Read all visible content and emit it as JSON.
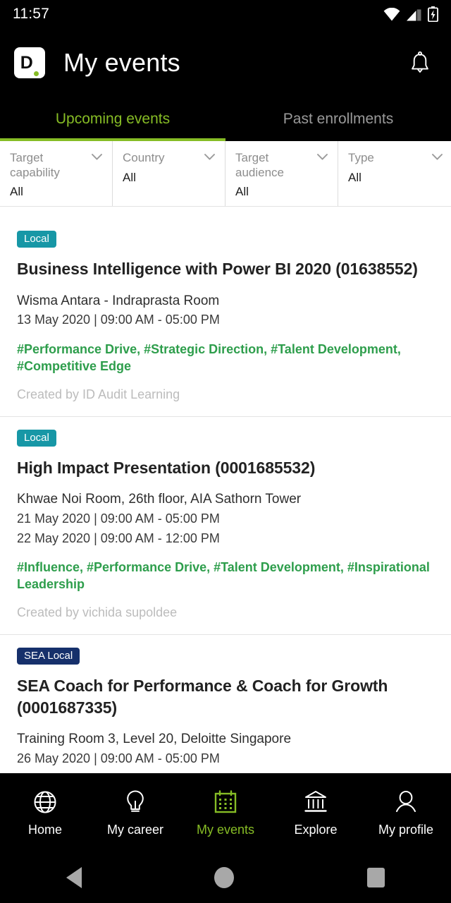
{
  "status_bar": {
    "time": "11:57",
    "icons": [
      "wifi-icon",
      "cellular-signal-icon",
      "battery-charging-icon"
    ]
  },
  "app_bar": {
    "logo_letter": "D",
    "logo_name": "deloitte-logo",
    "title": "My events",
    "notification_icon": "bell-icon"
  },
  "tabs": [
    {
      "label": "Upcoming events",
      "active": true
    },
    {
      "label": "Past enrollments",
      "active": false
    }
  ],
  "filters": [
    {
      "label": "Target capability",
      "value": "All"
    },
    {
      "label": "Country",
      "value": "All"
    },
    {
      "label": "Target audience",
      "value": "All"
    },
    {
      "label": "Type",
      "value": "All"
    }
  ],
  "events": [
    {
      "badge": "Local",
      "badge_type": "local",
      "title": "Business Intelligence with Power BI 2020 (01638552)",
      "venue": "Wisma Antara - Indraprasta Room",
      "dates": [
        "13 May 2020 | 09:00 AM - 05:00 PM"
      ],
      "tags": "#Performance Drive, #Strategic Direction, #Talent Development, #Competitive Edge",
      "author": "Created by ID Audit Learning"
    },
    {
      "badge": "Local",
      "badge_type": "local",
      "title": "High Impact Presentation (0001685532)",
      "venue": "Khwae Noi Room, 26th floor, AIA Sathorn Tower",
      "dates": [
        "21 May 2020 | 09:00 AM - 05:00 PM",
        "22 May 2020 | 09:00 AM - 12:00 PM"
      ],
      "tags": "#Influence, #Performance Drive, #Talent Development, #Inspirational Leadership",
      "author": "Created by vichida supoldee"
    },
    {
      "badge": "SEA Local",
      "badge_type": "sea",
      "title": "SEA Coach for Performance & Coach for Growth (0001687335)",
      "venue": "Training Room 3, Level 20, Deloitte Singapore",
      "dates": [
        "26 May 2020 | 09:00 AM - 05:00 PM"
      ],
      "tags": "",
      "author": ""
    }
  ],
  "bottom_nav": [
    {
      "label": "Home",
      "icon": "globe-icon",
      "active": false
    },
    {
      "label": "My career",
      "icon": "lightbulb-icon",
      "active": false
    },
    {
      "label": "My events",
      "icon": "calendar-icon",
      "active": true
    },
    {
      "label": "Explore",
      "icon": "bank-icon",
      "active": false
    },
    {
      "label": "My profile",
      "icon": "person-icon",
      "active": false
    }
  ],
  "system_nav": [
    {
      "name": "back-button"
    },
    {
      "name": "home-button"
    },
    {
      "name": "recents-button"
    }
  ],
  "colors": {
    "accent_green": "#86bc25",
    "tag_green": "#2e9e4c",
    "badge_local": "#1797a6",
    "badge_sea": "#16306b"
  }
}
